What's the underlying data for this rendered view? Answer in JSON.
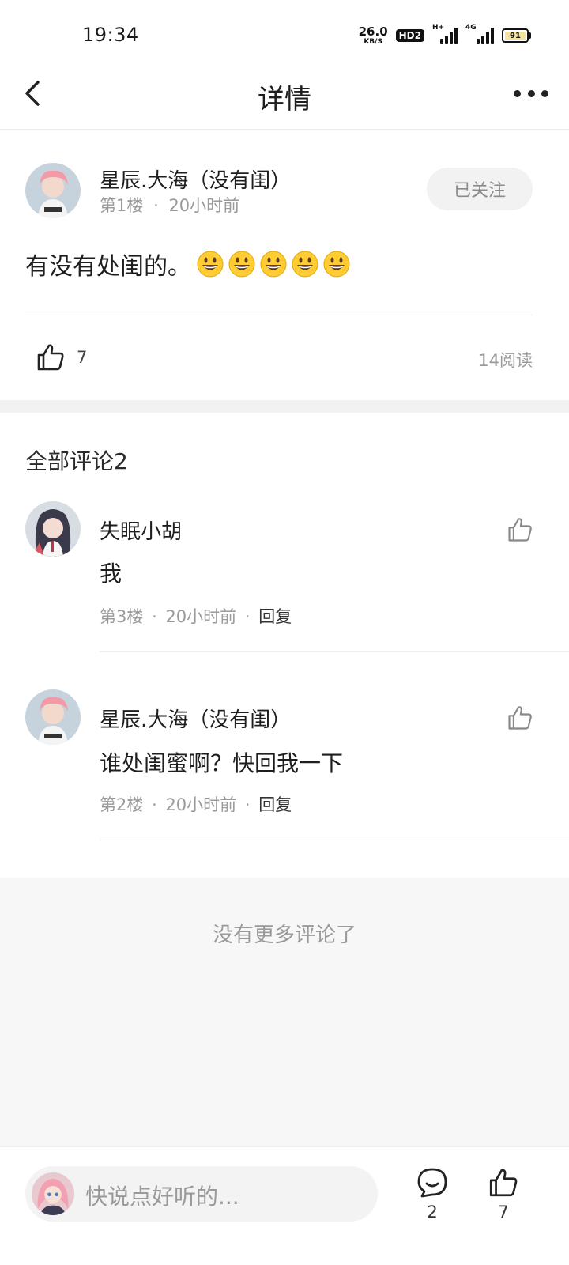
{
  "status_bar": {
    "time": "19:34",
    "net_speed_value": "26.0",
    "net_speed_unit": "KB/S",
    "hd_badge": "HD2",
    "signal_1_label": "H+",
    "signal_2_label": "4G",
    "battery_level": "91"
  },
  "nav": {
    "title": "详情",
    "back_icon": "chevron-left-icon",
    "more_icon": "more-dots-icon"
  },
  "post": {
    "author": "星辰.大海（没有闺）",
    "floor": "第1楼",
    "separator": "·",
    "time": "20小时前",
    "follow_label": "已关注",
    "content": "有没有处闺的。",
    "emoji_count": 5,
    "like_count": "7",
    "read_count": "14阅读"
  },
  "comments": {
    "title": "全部评论2",
    "items": [
      {
        "author": "失眠小胡",
        "text": "我",
        "floor": "第3楼",
        "time": "20小时前",
        "reply": "回复"
      },
      {
        "author": "星辰.大海（没有闺）",
        "text": "谁处闺蜜啊？快回我一下",
        "floor": "第2楼",
        "time": "20小时前",
        "reply": "回复"
      }
    ],
    "no_more": "没有更多评论了"
  },
  "bottom_bar": {
    "input_placeholder": "快说点好听的...",
    "comment_count": "2",
    "like_count": "7"
  },
  "colors": {
    "primary_text": "#1e1e1e",
    "secondary_text": "#9a9a9a",
    "divider": "#eeeeee",
    "follow_bg": "#f2f2f2",
    "page_gap": "#f2f2f2",
    "emoji_yellow": "#ffcc33"
  }
}
